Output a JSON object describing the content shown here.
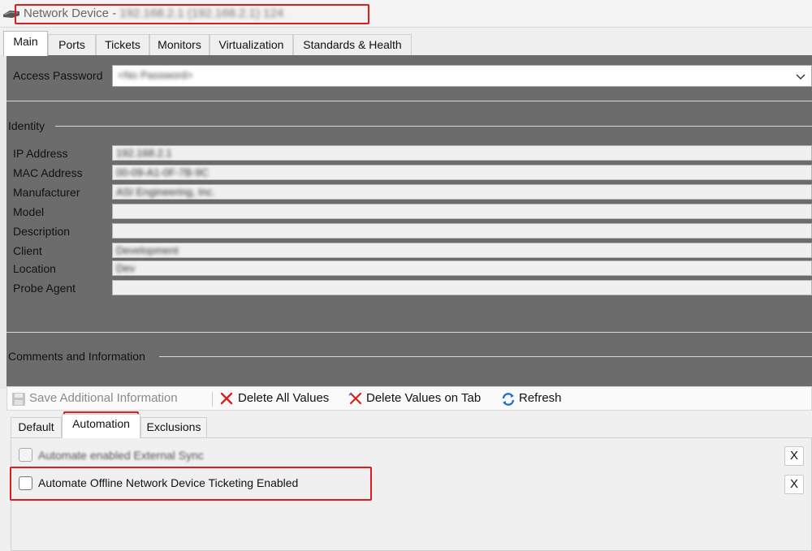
{
  "window": {
    "title_prefix": "Network Device - ",
    "title_redacted": "192.168.2.1 (192.168.2.1) 124"
  },
  "tabs": [
    "Main",
    "Ports",
    "Tickets",
    "Monitors",
    "Virtualization",
    "Standards & Health"
  ],
  "active_tab": "Main",
  "access_password": {
    "label": "Access Password",
    "value_redacted": "<No Password>"
  },
  "identity": {
    "section_label": "Identity",
    "fields": [
      {
        "label": "IP Address",
        "value_redacted": "192.168.2.1"
      },
      {
        "label": "MAC Address",
        "value_redacted": "00-09-A1-0F-7B-9C"
      },
      {
        "label": "Manufacturer",
        "value_redacted": "ASI Engineering, Inc."
      },
      {
        "label": "Model",
        "value_redacted": ""
      },
      {
        "label": "Description",
        "value_redacted": ""
      },
      {
        "label": "Client",
        "value_redacted": "Development"
      },
      {
        "label": "Location",
        "value_redacted": "Dev"
      },
      {
        "label": "Probe Agent",
        "value_redacted": ""
      }
    ]
  },
  "comments_section_label": "Comments and Information",
  "toolbar": {
    "save": "Save Additional Information",
    "delete_all": "Delete All Values",
    "delete_tab": "Delete Values on Tab",
    "refresh": "Refresh"
  },
  "subtabs": [
    "Default",
    "Automation",
    "Exclusions"
  ],
  "active_subtab": "Automation",
  "automation": {
    "row1_label_redacted": "Automate enabled External Sync",
    "row2_label": "Automate Offline Network Device Ticketing Enabled",
    "row2_checked": false,
    "clear_label": "X"
  },
  "colors": {
    "highlight": "#d81e1e",
    "panel": "#6c6c6c",
    "delete_icon": "#d42020",
    "refresh_icon": "#1f6fd1"
  }
}
